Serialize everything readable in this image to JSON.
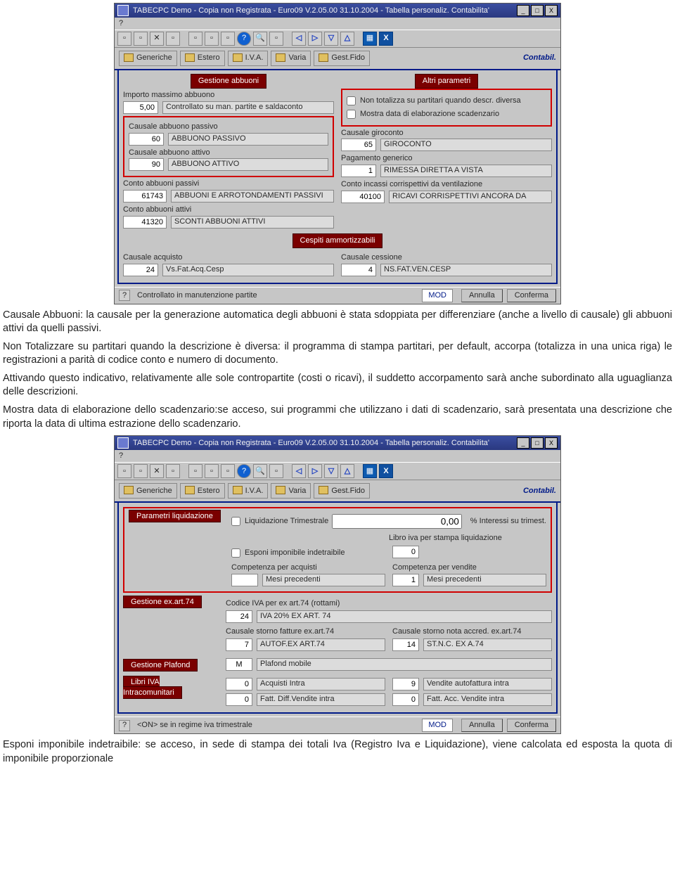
{
  "win1": {
    "title": "TABECPC  Demo - Copia non Registrata      - Euro09 V.2.05.00 31.10.2004 - Tabella personaliz. Contabilita'",
    "menu": "?",
    "brand": "Contabil.",
    "tabs": [
      "Generiche",
      "Estero",
      "I.V.A.",
      "Varia",
      "Gest.Fido"
    ],
    "grpAbbuoni": "Gestione abbuoni",
    "grpAltri": "Altri parametri",
    "importoLbl": "Importo massimo abbuono",
    "importoVal": "5,00",
    "importoDesc": "Controllato su man. partite e saldaconto",
    "causPassLbl": "Causale abbuono passivo",
    "causPassVal": "60",
    "causPassDesc": "ABBUONO PASSIVO",
    "causAttLbl": "Causale abbuono attivo",
    "causAttVal": "90",
    "causAttDesc": "ABBUONO ATTIVO",
    "contoPassLbl": "Conto abbuoni passivi",
    "contoPassVal": "61743",
    "contoPassDesc": "ABBUONI E ARROTONDAMENTI PASSIVI",
    "contoAttLbl": "Conto abbuoni attivi",
    "contoAttVal": "41320",
    "contoAttDesc": "SCONTI ABBUONI ATTIVI",
    "chkNonTot": "Non totalizza su partitari quando descr. diversa",
    "chkMostra": "Mostra data di elaborazione scadenzario",
    "causGiroLbl": "Causale giroconto",
    "causGiroVal": "65",
    "causGiroDesc": "GIROCONTO",
    "pagGenLbl": "Pagamento generico",
    "pagGenVal": "1",
    "pagGenDesc": "RIMESSA DIRETTA A VISTA",
    "contoIncLbl": "Conto incassi corrispettivi da ventilazione",
    "contoIncVal": "40100",
    "contoIncDesc": "RICAVI CORRISPETTIVI ANCORA DA",
    "grpCespiti": "Cespiti ammortizzabili",
    "causAcqLbl": "Causale acquisto",
    "causAcqVal": "24",
    "causAcqDesc": "Vs.Fat.Acq.Cesp",
    "causCessLbl": "Causale cessione",
    "causCessVal": "4",
    "causCessDesc": "NS.FAT.VEN.CESP",
    "statusMsg": "Controllato in manutenzione partite",
    "statusMod": "MOD",
    "btnAnnulla": "Annulla",
    "btnConferma": "Conferma"
  },
  "para1": "Causale Abbuoni: la causale per la generazione automatica degli abbuoni è stata sdoppiata per differenziare (anche a livello di causale) gli abbuoni attivi da quelli passivi.",
  "para2": "Non Totalizzare su partitari quando la descrizione è diversa: il programma di stampa partitari, per default, accorpa (totalizza in una unica riga) le registrazioni a parità di codice conto e numero di documento.",
  "para3": "Attivando questo indicativo, relativamente alle sole contropartite (costi o ricavi), il suddetto accorpamento sarà anche subordinato alla uguaglianza delle descrizioni.",
  "para4": "Mostra data di elaborazione dello scadenzario:se acceso, sui programmi che utilizzano i dati di scadenzario, sarà presentata una descrizione che riporta la data di ultima estrazione dello scadenzario.",
  "win2": {
    "title": "TABECPC  Demo - Copia non Registrata      - Euro09 V.2.05.00 31.10.2004 - Tabella personaliz. Contabilita'",
    "menu": "?",
    "brand": "Contabil.",
    "tabs": [
      "Generiche",
      "Estero",
      "I.V.A.",
      "Varia",
      "Gest.Fido"
    ],
    "grpLiq": "Parametri liquidazione",
    "chkLiqTrim": "Liquidazione Trimestrale",
    "intVal": "0,00",
    "intLbl": "% Interessi su trimest.",
    "libroLbl": "Libro iva per stampa liquidazione",
    "libroVal": "0",
    "chkEsponi": "Esponi imponibile indetraibile",
    "compAcqLbl": "Competenza per acquisti",
    "compAcqDesc": "Mesi precedenti",
    "compVenLbl": "Competenza per vendite",
    "compVenVal": "1",
    "compVenDesc": "Mesi precedenti",
    "grpArt74": "Gestione ex.art.74",
    "codIvaLbl": "Codice IVA per ex art.74 (rottami)",
    "codIvaVal": "24",
    "codIvaDesc": "IVA 20% EX ART. 74",
    "causStorFatLbl": "Causale storno fatture ex.art.74",
    "causStorFatVal": "7",
    "causStorFatDesc": "AUTOF.EX ART.74",
    "causStorNotLbl": "Causale storno nota accred. ex.art.74",
    "causStorNotVal": "14",
    "causStorNotDesc": "ST.N.C. EX A.74",
    "grpPlaf": "Gestione Plafond",
    "plafVal": "M",
    "plafDesc": "Plafond mobile",
    "grpIntra": "Libri IVA Intracomunitari",
    "acqIntraVal": "0",
    "acqIntraDesc": "Acquisti Intra",
    "venAutoVal": "9",
    "venAutoDesc": "Vendite autofattura intra",
    "fatDiffVal": "0",
    "fatDiffDesc": "Fatt. Diff.Vendite intra",
    "fatAccVal": "0",
    "fatAccDesc": "Fatt. Acc. Vendite intra",
    "statusMsg": "<ON> se in regime iva trimestrale",
    "statusMod": "MOD",
    "btnAnnulla": "Annulla",
    "btnConferma": "Conferma"
  },
  "para5": "Esponi imponibile indetraibile: se acceso, in sede di stampa dei totali Iva (Registro Iva e Liquidazione), viene calcolata ed esposta la quota di imponibile proporzionale"
}
